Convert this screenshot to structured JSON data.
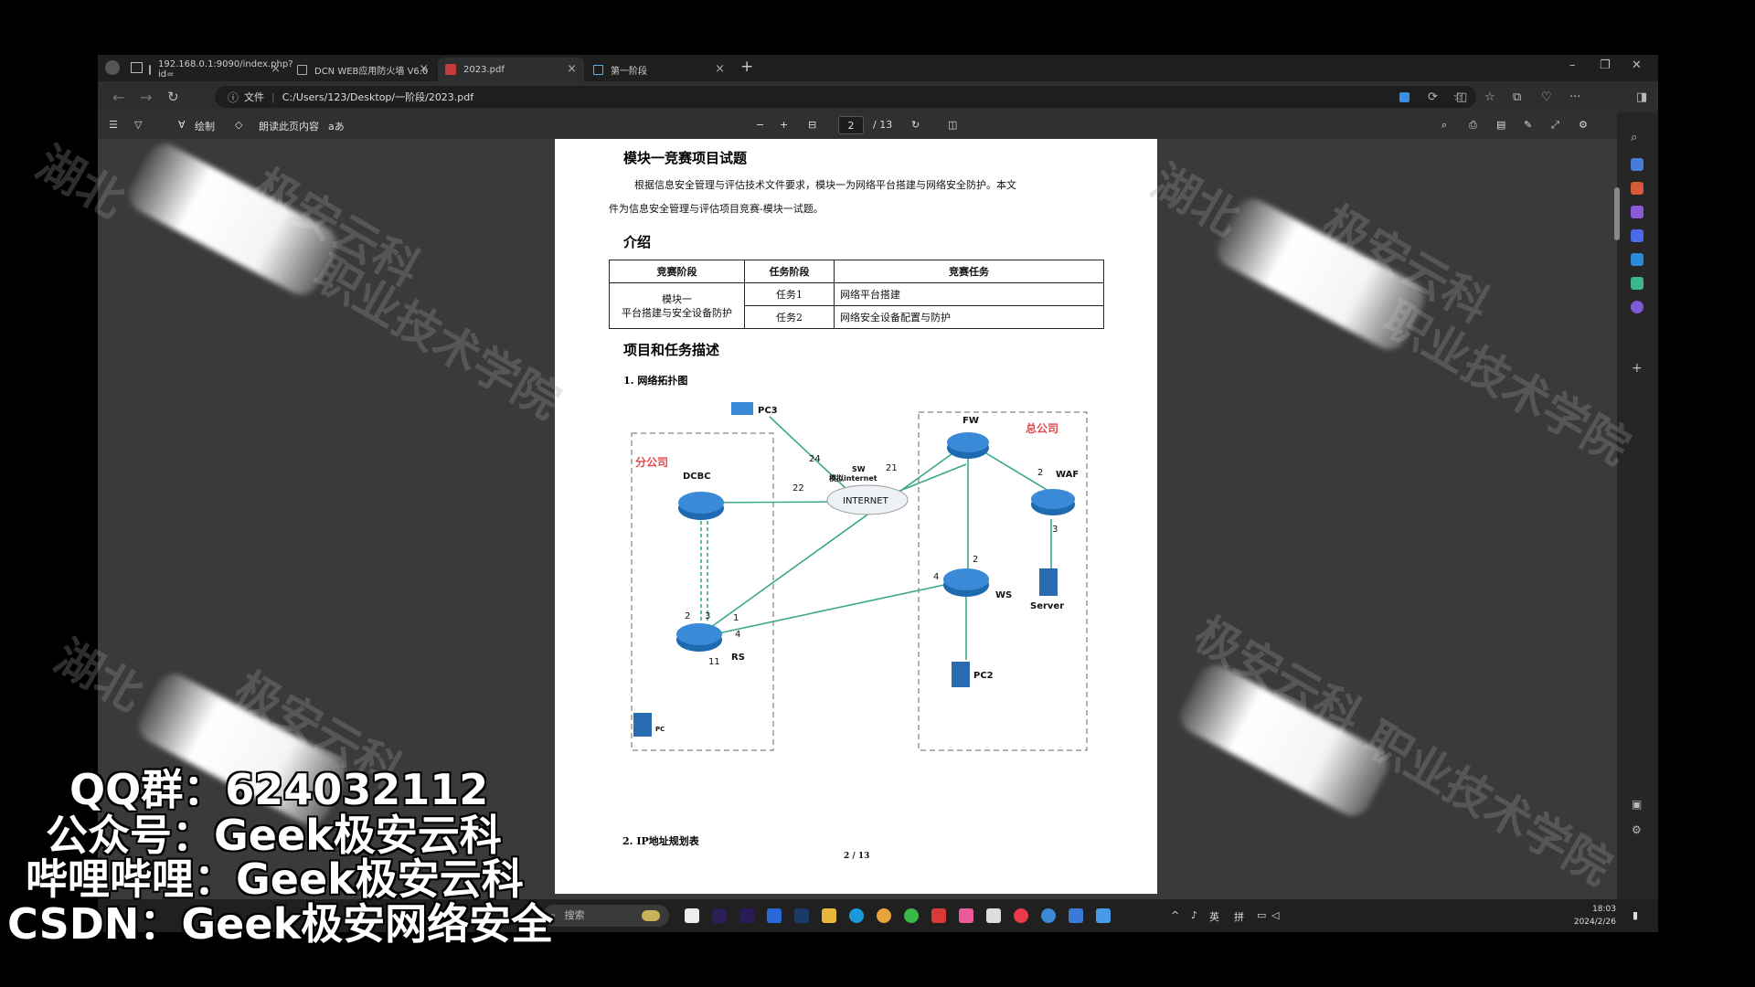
{
  "tabs": [
    {
      "title": "192.168.0.1:9090/index.php?id=",
      "active": false
    },
    {
      "title": "DCN WEB应用防火墙 V6.0",
      "active": false
    },
    {
      "title": "2023.pdf",
      "active": true
    },
    {
      "title": "第一阶段",
      "active": false
    }
  ],
  "address": {
    "label": "文件",
    "url": "C:/Users/123/Desktop/一阶段/2023.pdf"
  },
  "pdf_toolbar": {
    "draw_label": "绘制",
    "read_aloud_label": "朗读此页内容",
    "zoom_out": "−",
    "zoom_in": "+",
    "current_page": "2",
    "total_pages": "/ 13"
  },
  "document": {
    "title": "模块一竞赛项目试题",
    "intro_paragraph_1": "根据信息安全管理与评估技术文件要求，模块一为网络平台搭建与网络安全防护。本文",
    "intro_paragraph_2": "件为信息安全管理与评估项目竞赛-模块一试题。",
    "section_intro": "介绍",
    "table": {
      "headers": [
        "竞赛阶段",
        "任务阶段",
        "竞赛任务"
      ],
      "stage": "模块一\n平台搭建与安全设备防护",
      "rows": [
        {
          "task": "任务1",
          "content": "网络平台搭建"
        },
        {
          "task": "任务2",
          "content": "网络安全设备配置与防护"
        }
      ]
    },
    "section_tasks": "项目和任务描述",
    "sub_topology": "1. 网络拓扑图",
    "sub_ip": "2. IP地址规划表",
    "page_footer": "2 / 13"
  },
  "topology": {
    "branch_label": "分公司",
    "hq_label": "总公司",
    "devices": {
      "pc3": "PC3",
      "dcbc": "DCBC",
      "sw": "SW",
      "sw_sub": "模拟internet",
      "internet": "INTERNET",
      "fw": "FW",
      "waf": "WAF",
      "ws": "WS",
      "server": "Server",
      "pc2": "PC2",
      "rs": "RS",
      "pc1": "PC"
    },
    "port_labels": {
      "p24": "24",
      "p21": "21",
      "p22": "22",
      "waf2": "2",
      "waf3": "3",
      "ws2": "2",
      "ws4": "4",
      "rs2": "2",
      "rs3": "3",
      "rs1": "1",
      "rs4": "4",
      "rs11": "11"
    }
  },
  "watermark": {
    "line1": "湖北",
    "line2": "极安云科",
    "line3": "职业技术学院"
  },
  "taskbar": {
    "search_placeholder": "搜索",
    "ime_lang": "英",
    "ime_mode": "拼",
    "time": "18:03",
    "date": "2024/2/26"
  },
  "overlay": {
    "qq": "QQ群：624032112",
    "wechat": "公众号：Geek极安云科",
    "bilibili": "哔哩哔哩：Geek极安云科",
    "csdn": "CSDN：Geek极安网络安全"
  }
}
